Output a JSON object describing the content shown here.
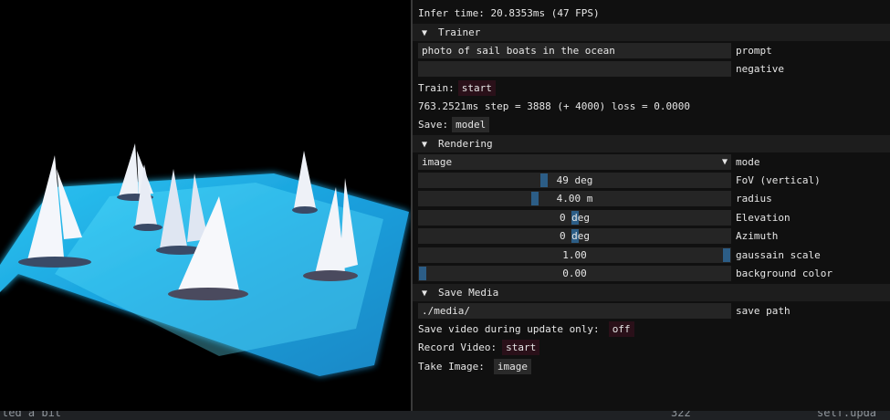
{
  "panel": {
    "infer_time": "Infer time:  20.8353ms (47 FPS)",
    "trainer": {
      "header": "Trainer",
      "prompt_value": "photo of sail boats in the ocean",
      "prompt_label": "prompt",
      "negative_value": "",
      "negative_label": "negative",
      "train_label": "Train:",
      "train_button": "start",
      "stats": "763.2521ms step =  3888 (+ 4000) loss = 0.0000",
      "save_label": "Save:",
      "save_button": "model"
    },
    "rendering": {
      "header": "Rendering",
      "mode_value": "image",
      "mode_label": "mode",
      "fov_value": "49 deg",
      "fov_label": "FoV (vertical)",
      "fov_level": 0.4,
      "radius_value": "4.00 m",
      "radius_label": "radius",
      "radius_level": 0.37,
      "elevation_value": "0 deg",
      "elevation_label": "Elevation",
      "elevation_level": 0.5,
      "azimuth_value": "0 deg",
      "azimuth_label": "Azimuth",
      "azimuth_level": 0.5,
      "scale_value": "1.00",
      "scale_label": "gaussain scale",
      "scale_level": 1.0,
      "bg_value": "0.00",
      "bg_label": "background color",
      "bg_level": 0.0
    },
    "save_media": {
      "header": "Save Media",
      "path_value": "./media/",
      "path_label": "save path",
      "video_update_label": "Save video during update only:",
      "video_update_button": "off",
      "record_label": "Record Video:",
      "record_button": "start",
      "take_label": "Take Image:",
      "take_button": "image"
    }
  },
  "statusbar": {
    "left_text": "ted a bit",
    "mid_text": "322",
    "right_text": "self.upda"
  },
  "colors": {
    "panel_bg": "#101010",
    "header_bg": "#1d1d1d",
    "field_bg": "#252525",
    "slider_grab": "#2c5d86",
    "button_bg": "#2a1019",
    "water": "#27c3ff"
  }
}
